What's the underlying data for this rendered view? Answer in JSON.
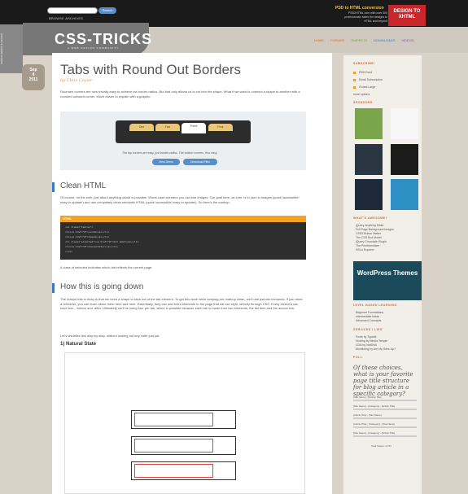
{
  "top": {
    "search_placeholder": "",
    "search_button": "Search",
    "browse": "BROWSE ARCHIVES",
    "psd_title": "PSD to HTML conversion",
    "psd_desc": "PSD2HTML.com with over 300 professionals takes the designs to HTML and beyond",
    "psd_logo": "DESIGN TO XHTML",
    "ribbon": "WORDS WEBSITE DESIGN"
  },
  "header": {
    "logo": "CSS-TRICKS",
    "tagline": "A WEB DESIGN COMMUNITY",
    "nav": [
      "HOME",
      "FORUMS",
      "SNIPPETS",
      "DOWNLOADS",
      "VIDEOS"
    ]
  },
  "post": {
    "date_month": "Sep",
    "date_day": "4",
    "date_year": "2011",
    "title": "Tabs with Round Out Borders",
    "byline": "by Chris Coyier",
    "intro": "Rounded corners are now trivially easy to achieve via border-radius. But that only allows us to cut into the shape. What if we want to connect a shape to another with a rounded outward corner. Much easier to explain with a graphic:",
    "tabs": [
      "One",
      "Two",
      "Three",
      "Four"
    ],
    "caption": "The top corners are easy, just border-radius. The bottom corners, less easy.",
    "view_demo": "View Demo",
    "download": "Download Files",
    "h_clean": "Clean HTML",
    "p_clean": "Of course, on the web, just about anything visual is possible. Worst-case scenario you can use images. Our goal here, as ever, is to use no images (quick! accessible! easy to update!) and use completely clean semantic HTML (quick! accessible! easy to update!). So here's the markup:",
    "code_label": "HTML",
    "code_lines": [
      "<ul class=\"tabrow\">",
      "   <li><a href=\"#\">Lorem</a></li>",
      "   <li><a href=\"#\">Ipsum</a></li>",
      "   <li class=\"selected\"><a href=\"#\">Sit amet</a></li>",
      "   <li><a href=\"#\">Consectetur</a></li>",
      "</ul>"
    ],
    "code_note": "A class of selected indicates which tab reflects the current page.",
    "h_how": "How this is going down",
    "p_how": "The reason this is tricky is that we need a shape to stick out of the tab element. To get this done while keeping our markup clean, we'll use pseudo elements. If you need a refresher, you can learn about them here and here. Essentially, they can add extra elements to the page that we can style, directly through CSS. Every element can have two - :before and :after. Ultimately we'll be using four per tab, which is possible because each tab is made from two elements, the list item and the anchor link.",
    "p_vis": "Let's visualize this step by step, without looking out any code just yet.",
    "h_natural": "1) Natural State"
  },
  "sidebar": {
    "subscribe": "SUBSCRIBE!",
    "subs": [
      "RSS Feed",
      "Email Subscription",
      "iTunes Large",
      "more options"
    ],
    "sponsors": "SPONSORS",
    "awesome": "WHAT'S AWESOME?",
    "awesome_items": [
      "jQuery Anything Slider",
      "Full Page Background Images",
      "CSS3 Button Maker",
      "The CSS Box Model",
      "jQuery Chocolate Plugin",
      "The Printfriendlizer",
      "HSLa Explorer"
    ],
    "wp_ad": "WordPress Themes",
    "learning": "LEVEL BASED LEARNING",
    "learning_items": [
      "Beginner Foundations",
      "Intermediate Ideas",
      "Advanced Concepts"
    ],
    "services": "SERVICES I LIKE",
    "services_items": [
      "Fonts by Typekit",
      "Hosting by Media Temple",
      "CDN by NetDNA",
      "Monitoring by Are My Sites Up?"
    ],
    "poll": "POLL",
    "poll_q": "Of these choices, what is your favorite page title structure for blog article in a specific category?",
    "poll_options": [
      "[Site Name] - [Article Title]",
      "[Site Name] - [Category] - [Article Title]",
      "[Article Title] - [Site Name]",
      "[Article Title] - [Category] - [Site Name]",
      "[Site Name] - [Category] - [Article Title]"
    ],
    "poll_total": "Total Voters: 4,374"
  }
}
